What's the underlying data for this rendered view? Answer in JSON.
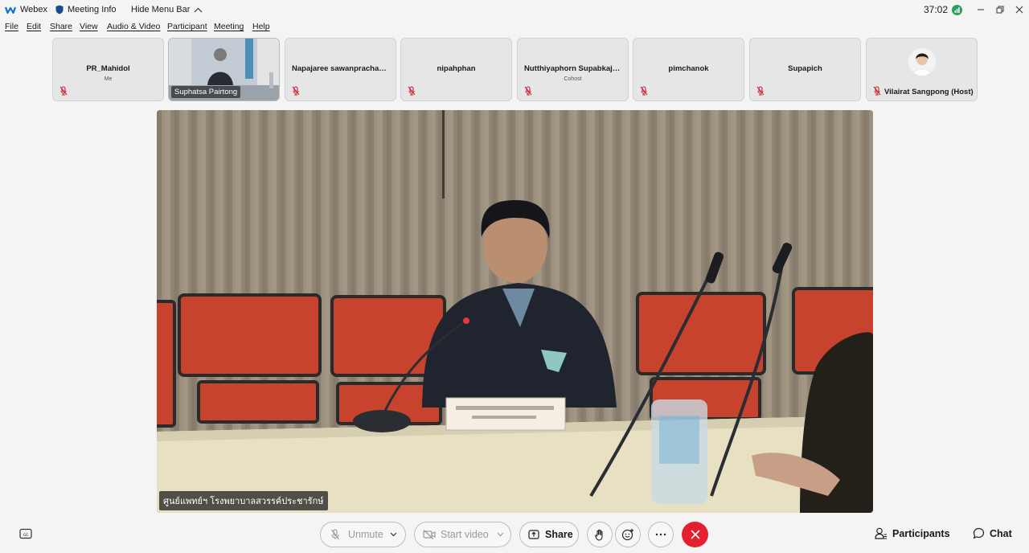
{
  "titlebar": {
    "app_name": "Webex",
    "meeting_info": "Meeting Info",
    "hide_menu_bar": "Hide Menu Bar",
    "timer": "37:02"
  },
  "menu": [
    "File",
    "Edit",
    "Share",
    "View",
    "Audio & Video",
    "Participant",
    "Meeting",
    "Help"
  ],
  "participants": [
    {
      "name": "PR_Mahidol",
      "role": "Me"
    },
    {
      "name": "Suphatsa Pairtong",
      "role": ""
    },
    {
      "name": "Napajaree sawanpracharak",
      "role": ""
    },
    {
      "name": "nipahphan",
      "role": ""
    },
    {
      "name": "Nutthiyaphorn Supabkaja...",
      "role": "Cohost"
    },
    {
      "name": "pimchanok",
      "role": ""
    },
    {
      "name": "Supapich",
      "role": ""
    },
    {
      "name": "Vilairat Sangpong (Host)",
      "role": ""
    }
  ],
  "main_video": {
    "label": "ศูนย์แพทย์ฯ โรงพยาบาลสวรรค์ประชารักษ์"
  },
  "toolbar": {
    "unmute": "Unmute",
    "start_video": "Start video",
    "share": "Share",
    "participants": "Participants",
    "chat": "Chat"
  },
  "colors": {
    "end_call": "#e5202e",
    "muted_icon": "#c8202c",
    "signal": "#2e9e5b"
  }
}
